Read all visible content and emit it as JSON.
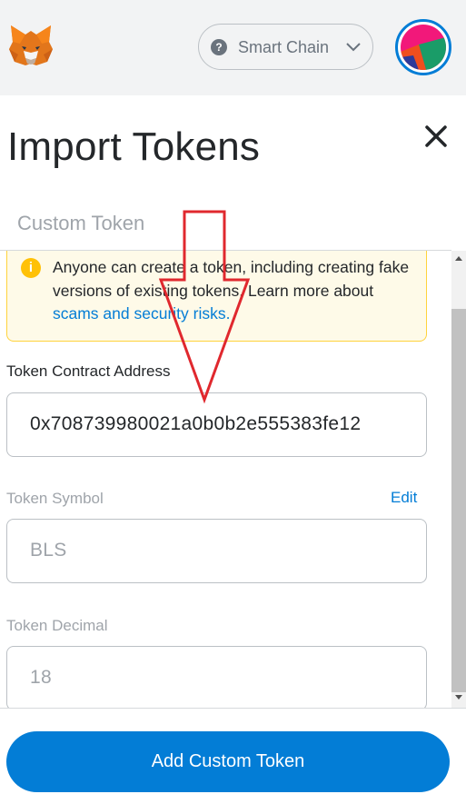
{
  "header": {
    "network": {
      "label": "Smart Chain",
      "icon": "question-icon"
    },
    "colors": {
      "bar_bg": "#f2f3f4",
      "accent": "#037dd6"
    }
  },
  "page": {
    "title": "Import Tokens",
    "tab": "Custom Token"
  },
  "warning": {
    "text": "Anyone can create a token, including creating fake versions of existing tokens. Learn more about ",
    "link": "scams and security risks."
  },
  "form": {
    "contract_address": {
      "label": "Token Contract Address",
      "value": "0x708739980021a0b0b2e555383fe12"
    },
    "symbol": {
      "label": "Token Symbol",
      "value": "BLS",
      "edit_label": "Edit"
    },
    "decimal": {
      "label": "Token Decimal",
      "value": "18"
    }
  },
  "footer": {
    "button_label": "Add Custom Token"
  }
}
